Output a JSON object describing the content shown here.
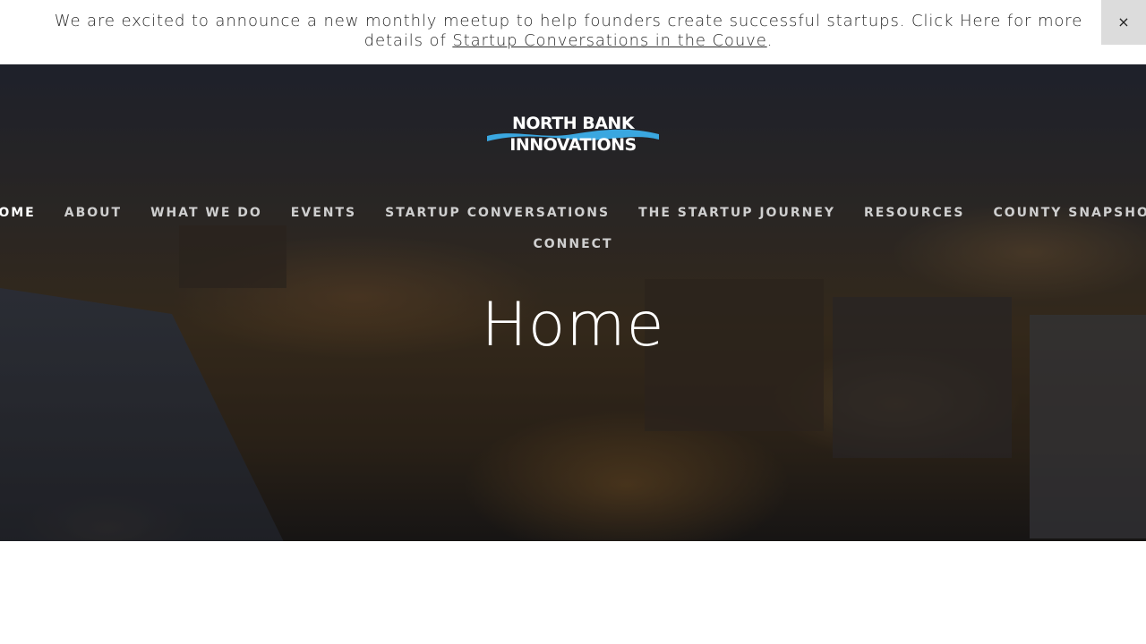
{
  "announcement": {
    "text": "We are excited to announce a new monthly meetup to help founders create successful startups. Click Here for more details of ",
    "link_label": "Startup Conversations in the Couve",
    "trailing": ".",
    "close_label": "×"
  },
  "logo": {
    "line1": "NORTH BANK",
    "line2": "INNOVATIONS",
    "accent_color": "#3aa7e0"
  },
  "nav": {
    "items": [
      {
        "label": "HOME",
        "active": true
      },
      {
        "label": "ABOUT"
      },
      {
        "label": "WHAT WE DO"
      },
      {
        "label": "EVENTS"
      },
      {
        "label": "STARTUP CONVERSATIONS"
      },
      {
        "label": "THE STARTUP JOURNEY"
      },
      {
        "label": "RESOURCES"
      },
      {
        "label": "COUNTY SNAPSHOT"
      },
      {
        "label": "CONNECT"
      }
    ]
  },
  "hero": {
    "title": "Home"
  }
}
